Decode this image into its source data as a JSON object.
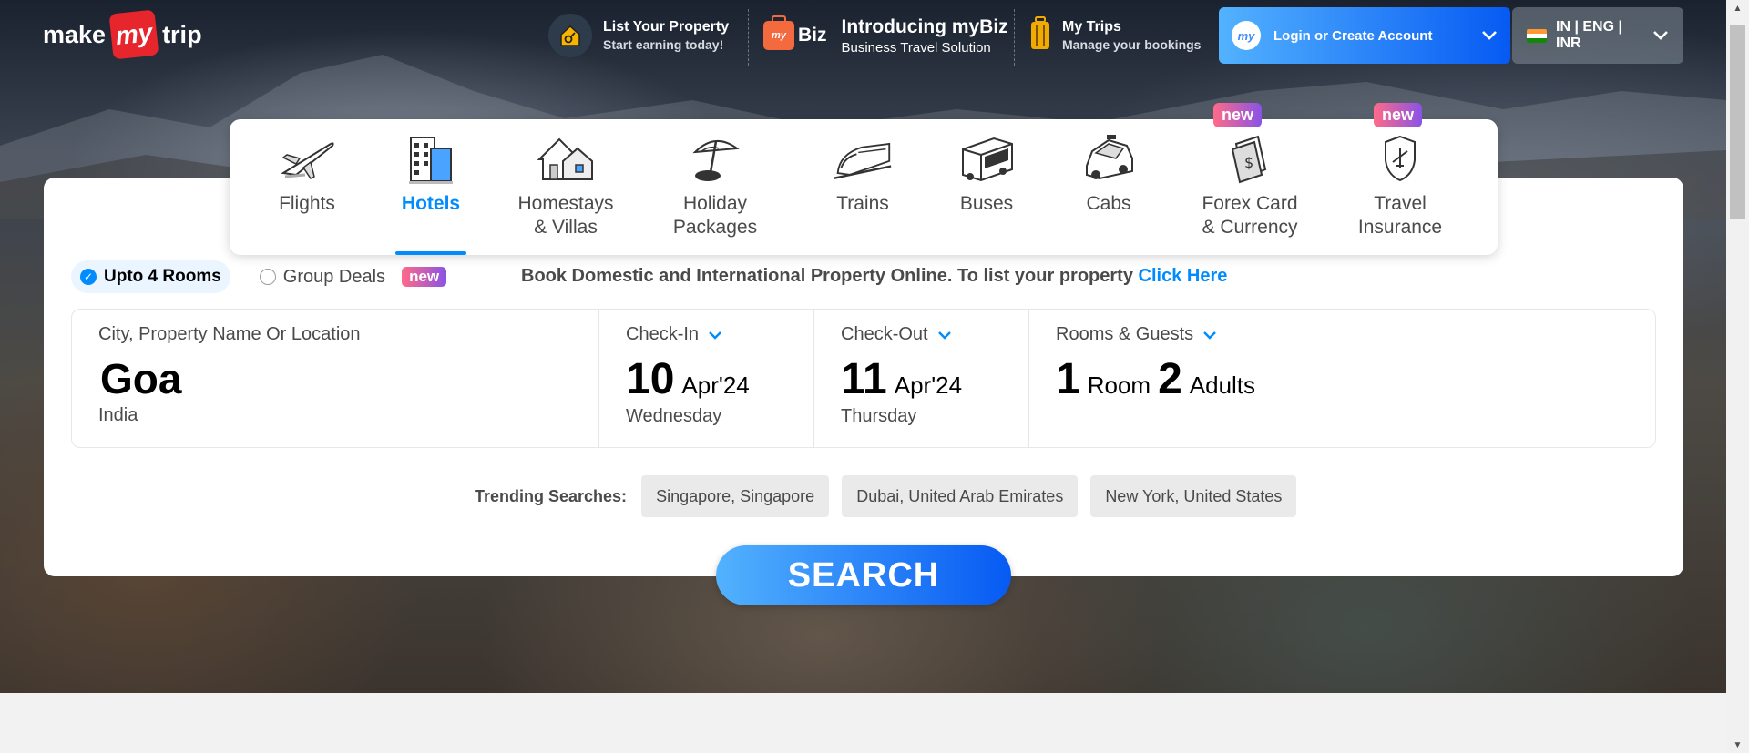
{
  "logo": {
    "part1": "make",
    "part2": "my",
    "part3": "trip"
  },
  "header": {
    "list_property": {
      "title": "List Your Property",
      "subtitle": "Start earning today!"
    },
    "mybiz": {
      "brand": "Biz",
      "brand_prefix": "my",
      "title": "Introducing myBiz",
      "subtitle": "Business Travel Solution"
    },
    "my_trips": {
      "title": "My Trips",
      "subtitle": "Manage your bookings"
    },
    "login": {
      "avatar": "my",
      "label": "Login or Create Account"
    },
    "locale": {
      "label": "IN | ENG | INR"
    }
  },
  "tabs": [
    {
      "label": "Flights",
      "icon": "plane-icon"
    },
    {
      "label": "Hotels",
      "icon": "hotel-icon",
      "active": true
    },
    {
      "label": "Homestays\n& Villas",
      "icon": "house-icon"
    },
    {
      "label": "Holiday\nPackages",
      "icon": "umbrella-icon"
    },
    {
      "label": "Trains",
      "icon": "train-icon"
    },
    {
      "label": "Buses",
      "icon": "bus-icon"
    },
    {
      "label": "Cabs",
      "icon": "cab-icon"
    },
    {
      "label": "Forex Card\n& Currency",
      "icon": "forex-icon",
      "badge": "new"
    },
    {
      "label": "Travel\nInsurance",
      "icon": "insurance-icon",
      "badge": "new"
    }
  ],
  "options": {
    "upto_rooms": "Upto 4 Rooms",
    "group_deals": "Group Deals",
    "new_tag": "new",
    "promo_text": "Book Domestic and International Property Online. To list your property",
    "promo_link": "Click Here"
  },
  "search": {
    "city": {
      "label": "City, Property Name Or Location",
      "value": "Goa",
      "sub": "India"
    },
    "checkin": {
      "label": "Check-In",
      "day": "10",
      "monthyear": "Apr'24",
      "weekday": "Wednesday"
    },
    "checkout": {
      "label": "Check-Out",
      "day": "11",
      "monthyear": "Apr'24",
      "weekday": "Thursday"
    },
    "guests": {
      "label": "Rooms & Guests",
      "rooms_num": "1",
      "rooms_word": "Room",
      "adults_num": "2",
      "adults_word": "Adults"
    }
  },
  "trending": {
    "label": "Trending Searches:",
    "items": [
      "Singapore, Singapore",
      "Dubai, United Arab Emirates",
      "New York, United States"
    ]
  },
  "search_button": "SEARCH",
  "colors": {
    "primary": "#008cff",
    "logo_red": "#e7252d",
    "gradient_start": "#53b2fe",
    "gradient_end": "#065af3"
  }
}
